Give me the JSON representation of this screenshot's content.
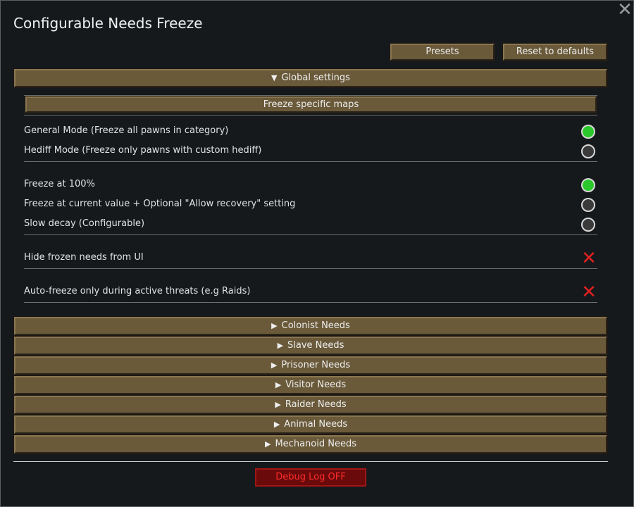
{
  "window": {
    "title": "Configurable Needs Freeze"
  },
  "toolbar": {
    "presets_label": "Presets",
    "reset_label": "Reset to defaults"
  },
  "global": {
    "header": "Global settings",
    "freeze_maps_label": "Freeze specific maps",
    "mode_options": [
      {
        "label": "General Mode (Freeze all pawns in category)",
        "selected": true
      },
      {
        "label": "Hediff Mode (Freeze only pawns with custom hediff)",
        "selected": false
      }
    ],
    "freeze_options": [
      {
        "label": "Freeze at 100%",
        "selected": true
      },
      {
        "label": "Freeze at current value + Optional \"Allow recovery\" setting",
        "selected": false
      },
      {
        "label": "Slow decay (Configurable)",
        "selected": false
      }
    ],
    "hide_frozen_label": "Hide frozen needs from UI",
    "hide_frozen_enabled": false,
    "auto_freeze_label": "Auto-freeze only during active threats (e.g Raids)",
    "auto_freeze_enabled": false
  },
  "sections": [
    {
      "label": "Colonist Needs"
    },
    {
      "label": "Slave Needs"
    },
    {
      "label": "Prisoner Needs"
    },
    {
      "label": "Visitor Needs"
    },
    {
      "label": "Raider Needs"
    },
    {
      "label": "Animal Needs"
    },
    {
      "label": "Mechanoid Needs"
    }
  ],
  "debug": {
    "label": "Debug Log OFF"
  },
  "icons": {
    "close": "close-icon",
    "collapse": "triangle-down-icon",
    "expand": "triangle-right-icon",
    "disabled": "red-x-icon"
  },
  "colors": {
    "button_bg": "#6a5a3a",
    "radio_on": "#2ac82a",
    "disabled_x": "#e02020",
    "debug_bg": "#6b0a0a",
    "debug_text": "#ff2d2d"
  }
}
